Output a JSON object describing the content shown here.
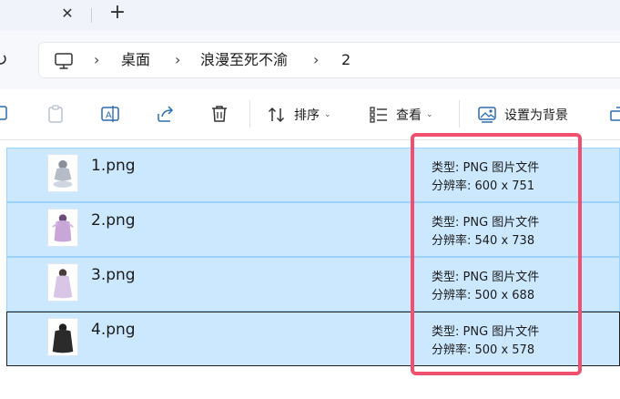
{
  "tabstrip": {
    "close_glyph": "✕",
    "new_tab_glyph": "+"
  },
  "address": {
    "refresh_glyph": "↻",
    "separator": "›",
    "crumbs": [
      "桌面",
      "浪漫至死不渝",
      "2"
    ]
  },
  "toolbar": {
    "sort_label": "排序",
    "view_label": "查看",
    "set_background_label": "设置为背景",
    "chevron": "⌄"
  },
  "files": [
    {
      "name": "1.png",
      "type": "类型: PNG 图片文件",
      "resolution": "分辨率: 600 x 751"
    },
    {
      "name": "2.png",
      "type": "类型: PNG 图片文件",
      "resolution": "分辨率: 540 x 738"
    },
    {
      "name": "3.png",
      "type": "类型: PNG 图片文件",
      "resolution": "分辨率: 500 x 688"
    },
    {
      "name": "4.png",
      "type": "类型: PNG 图片文件",
      "resolution": "分辨率: 500 x 578"
    }
  ],
  "colors": {
    "selection_fill": "#cce8ff",
    "selection_border": "#99d1ff",
    "highlight_box": "#f0506e"
  }
}
